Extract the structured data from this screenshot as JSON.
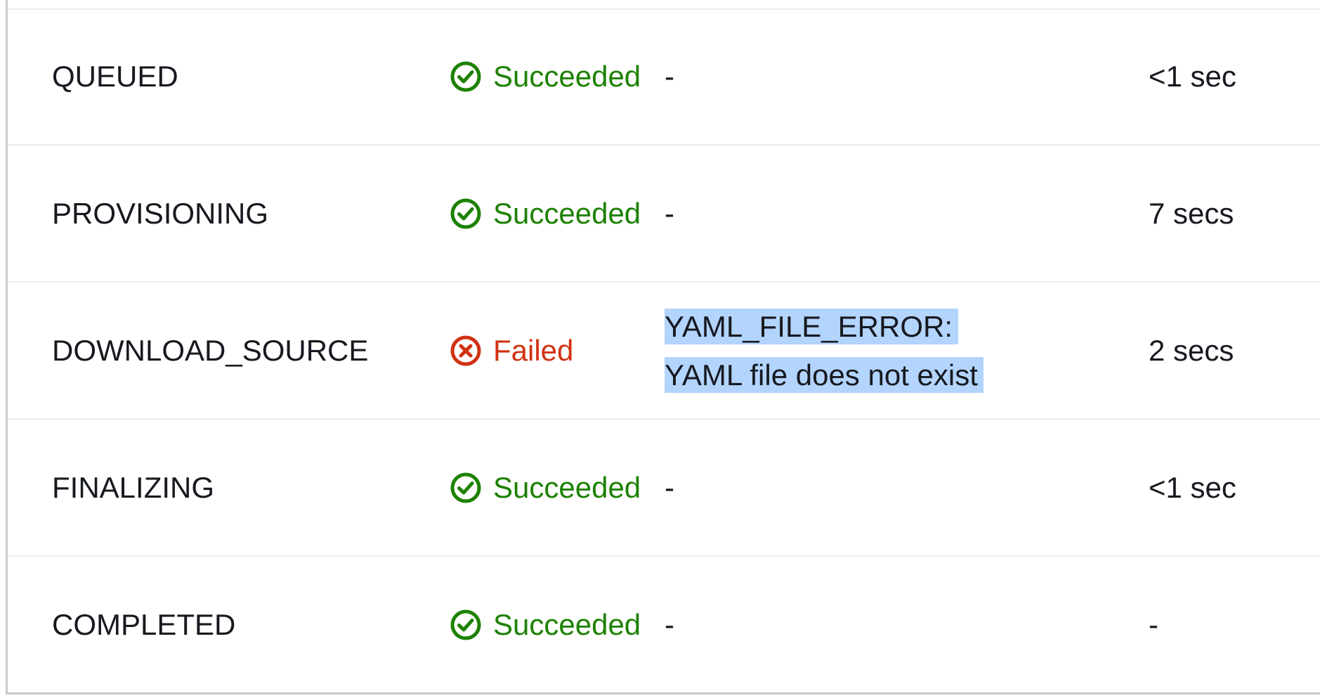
{
  "colors": {
    "success": "#1d8102",
    "failed": "#d13212",
    "text": "#16191f",
    "selection_highlight": "#b3d4fc",
    "divider": "#eaeded"
  },
  "rows": [
    {
      "phase": "QUEUED",
      "status": {
        "label": "Succeeded",
        "state": "success",
        "icon": "check-circle-icon"
      },
      "context": "-",
      "duration": "<1 sec"
    },
    {
      "phase": "PROVISIONING",
      "status": {
        "label": "Succeeded",
        "state": "success",
        "icon": "check-circle-icon"
      },
      "context": "-",
      "duration": "7 secs"
    },
    {
      "phase": "DOWNLOAD_SOURCE",
      "status": {
        "label": "Failed",
        "state": "failed",
        "icon": "x-circle-icon"
      },
      "context": "YAML_FILE_ERROR: YAML file does not exist",
      "duration": "2 secs"
    },
    {
      "phase": "FINALIZING",
      "status": {
        "label": "Succeeded",
        "state": "success",
        "icon": "check-circle-icon"
      },
      "context": "-",
      "duration": "<1 sec"
    },
    {
      "phase": "COMPLETED",
      "status": {
        "label": "Succeeded",
        "state": "success",
        "icon": "check-circle-icon"
      },
      "context": "-",
      "duration": "-"
    }
  ]
}
